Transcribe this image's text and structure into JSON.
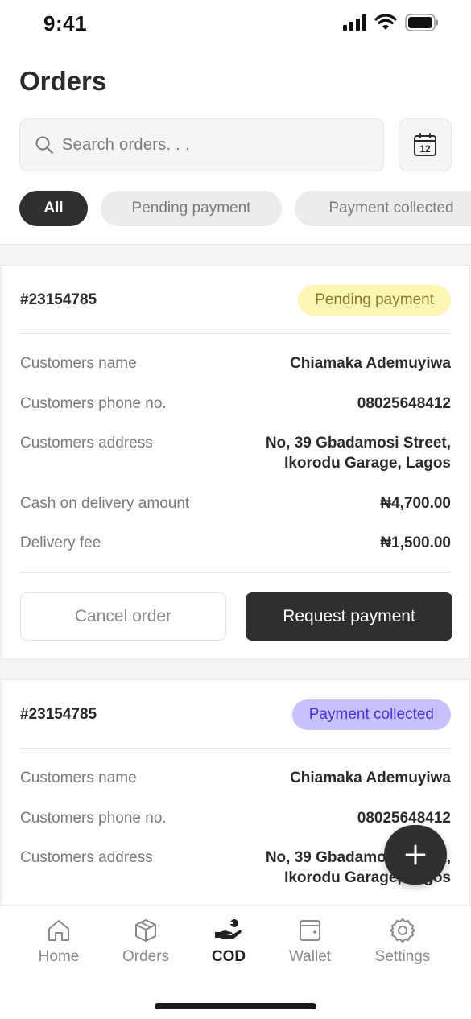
{
  "status_bar": {
    "time": "9:41"
  },
  "header": {
    "title": "Orders"
  },
  "search": {
    "placeholder": "Search orders. . ."
  },
  "calendar": {
    "day": "12"
  },
  "filters": [
    {
      "label": "All",
      "active": true
    },
    {
      "label": "Pending payment",
      "active": false
    },
    {
      "label": "Payment collected",
      "active": false
    }
  ],
  "orders": [
    {
      "id": "#23154785",
      "status": "Pending payment",
      "status_color": "#fbf6b4",
      "rows": [
        {
          "label": "Customers name",
          "value": "Chiamaka Ademuyiwa"
        },
        {
          "label": "Customers phone no.",
          "value": "08025648412"
        },
        {
          "label": "Customers address",
          "value_line1": "No, 39 Gbadamosi Street,",
          "value_line2": "Ikorodu Garage, Lagos"
        },
        {
          "label": "Cash on delivery amount",
          "value": "₦4,700.00"
        },
        {
          "label": "Delivery fee",
          "value": "₦1,500.00"
        }
      ],
      "cancel_label": "Cancel order",
      "request_label": "Request payment"
    },
    {
      "id": "#23154785",
      "status": "Payment collected",
      "status_color": "#c7c2ff",
      "rows": [
        {
          "label": "Customers name",
          "value": "Chiamaka Ademuyiwa"
        },
        {
          "label": "Customers phone no.",
          "value": "08025648412"
        },
        {
          "label": "Customers address",
          "value_line1": "No, 39 Gbadamosi Street,",
          "value_line2": "Ikorodu Garage, Lagos"
        }
      ]
    }
  ],
  "tabs": [
    {
      "label": "Home",
      "icon": "home-icon",
      "active": false
    },
    {
      "label": "Orders",
      "icon": "box-icon",
      "active": false
    },
    {
      "label": "COD",
      "icon": "cash-hand-icon",
      "active": true
    },
    {
      "label": "Wallet",
      "icon": "wallet-icon",
      "active": false
    },
    {
      "label": "Settings",
      "icon": "gear-icon",
      "active": false
    }
  ],
  "colors": {
    "dark": "#2f2f2f",
    "pending_bg": "#fbf6b4",
    "collected_bg": "#c7c2ff",
    "collected_text": "#4a36d8"
  }
}
